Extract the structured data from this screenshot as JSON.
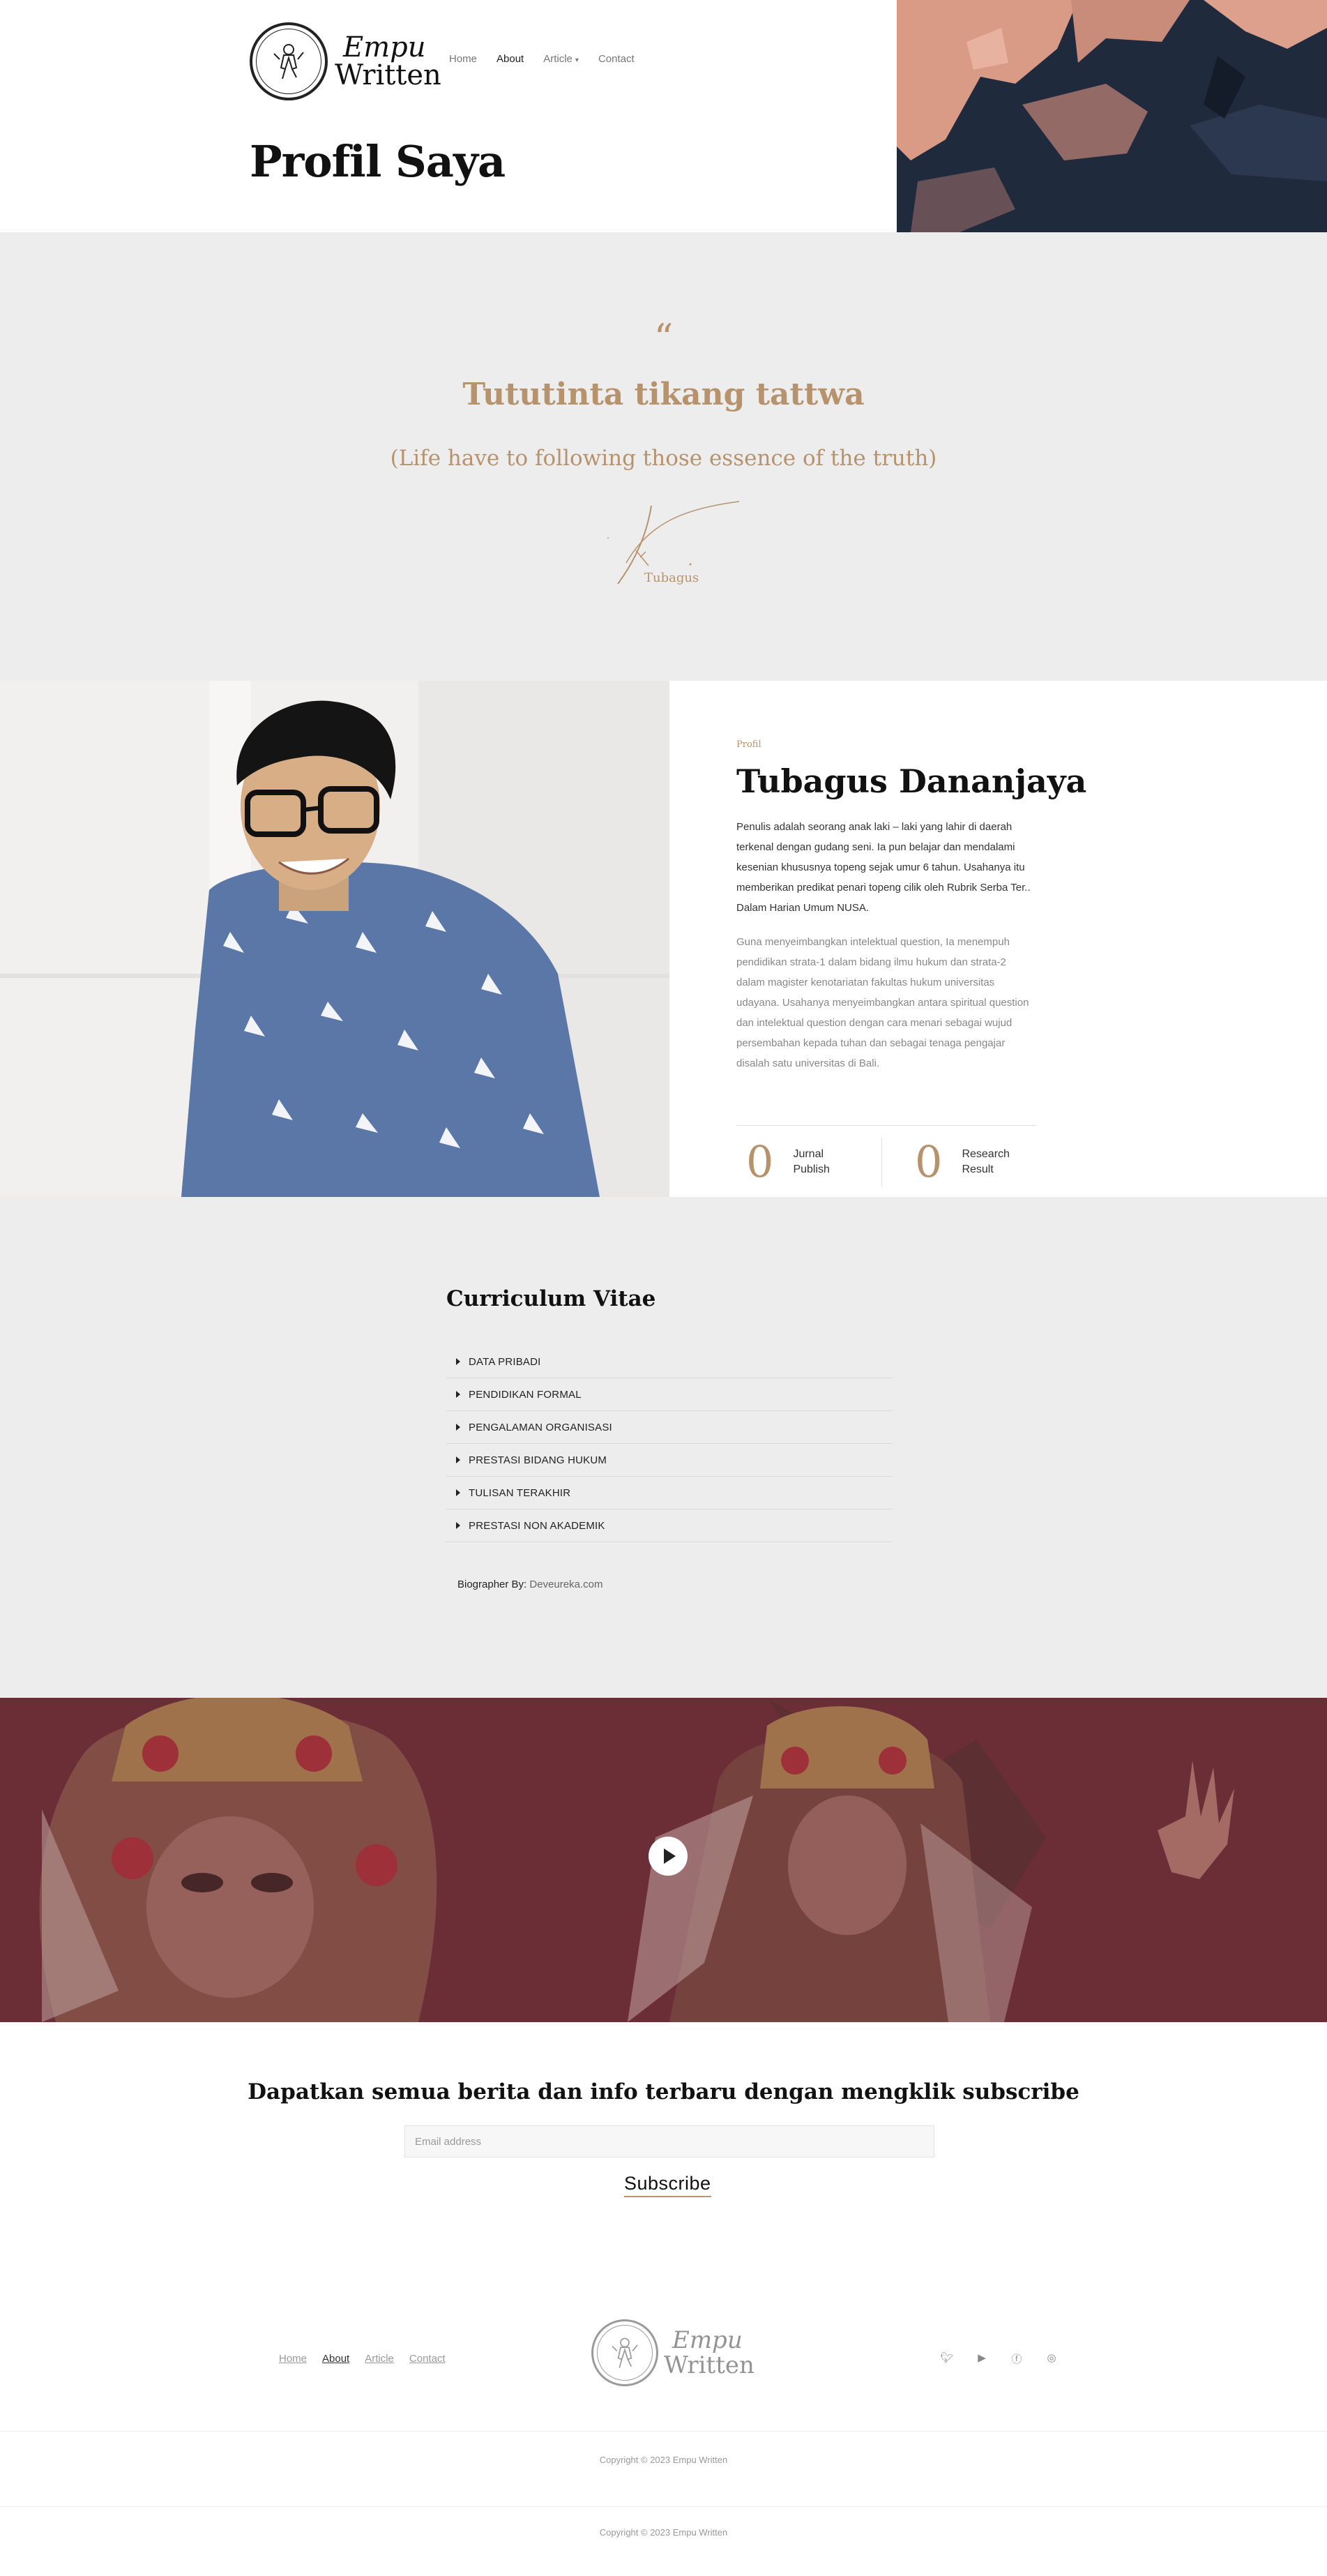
{
  "brand": {
    "name_line1": "Empu",
    "name_line2": "Written"
  },
  "nav": {
    "items": [
      "Home",
      "About",
      "Article",
      "Contact"
    ],
    "active": "About"
  },
  "page_title": "Profil Saya",
  "social_icons": [
    "twitter-icon",
    "youtube-icon",
    "facebook-icon",
    "instagram-icon"
  ],
  "quote": {
    "mark": "“",
    "title": "Tututinta tikang tattwa",
    "subtitle": "(Life have to following those essence of the truth)",
    "signature_name": "Tubagus"
  },
  "profile": {
    "eyebrow": "Profil",
    "name": "Tubagus Dananjaya",
    "paragraph1": "Penulis adalah seorang anak laki – laki yang lahir di daerah terkenal dengan gudang seni. Ia pun belajar dan mendalami kesenian khususnya topeng sejak umur 6 tahun. Usahanya itu memberikan predikat penari topeng cilik oleh Rubrik Serba Ter.. Dalam Harian Umum NUSA.",
    "paragraph2": "Guna menyeimbangkan intelektual question, Ia menempuh pendidikan strata-1 dalam bidang ilmu hukum dan strata-2 dalam magister kenotariatan fakultas hukum universitas udayana. Usahanya menyeimbangkan antara spiritual question dan intelektual question dengan cara menari sebagai wujud persembahan kepada tuhan dan sebagai tenaga pengajar disalah satu universitas di Bali.",
    "stats": [
      {
        "value": "0",
        "label": "Jurnal Publish"
      },
      {
        "value": "0",
        "label": "Research Result"
      }
    ]
  },
  "cv": {
    "title": "Curriculum Vitae",
    "items": [
      "DATA PRIBADI",
      "PENDIDIKAN FORMAL",
      "PENGALAMAN ORGANISASI",
      "PRESTASI BIDANG HUKUM",
      "TULISAN TERAKHIR",
      "PRESTASI NON AKADEMIK"
    ],
    "biographer_label": "Biographer By:",
    "biographer_value": "Deveureka.com"
  },
  "subscribe": {
    "title": "Dapatkan semua berita dan info terbaru dengan mengklik subscribe",
    "email_placeholder": "Email address",
    "button": "Subscribe"
  },
  "footer": {
    "nav": [
      "Home",
      "About",
      "Article",
      "Contact"
    ],
    "copyright1": "Copyright © 2023 Empu Written",
    "copyright2": "Copyright © 2023 Empu Written"
  },
  "colors": {
    "accent": "#b6936d",
    "section_bg": "#ededed",
    "video_overlay": "#5a2a32"
  }
}
